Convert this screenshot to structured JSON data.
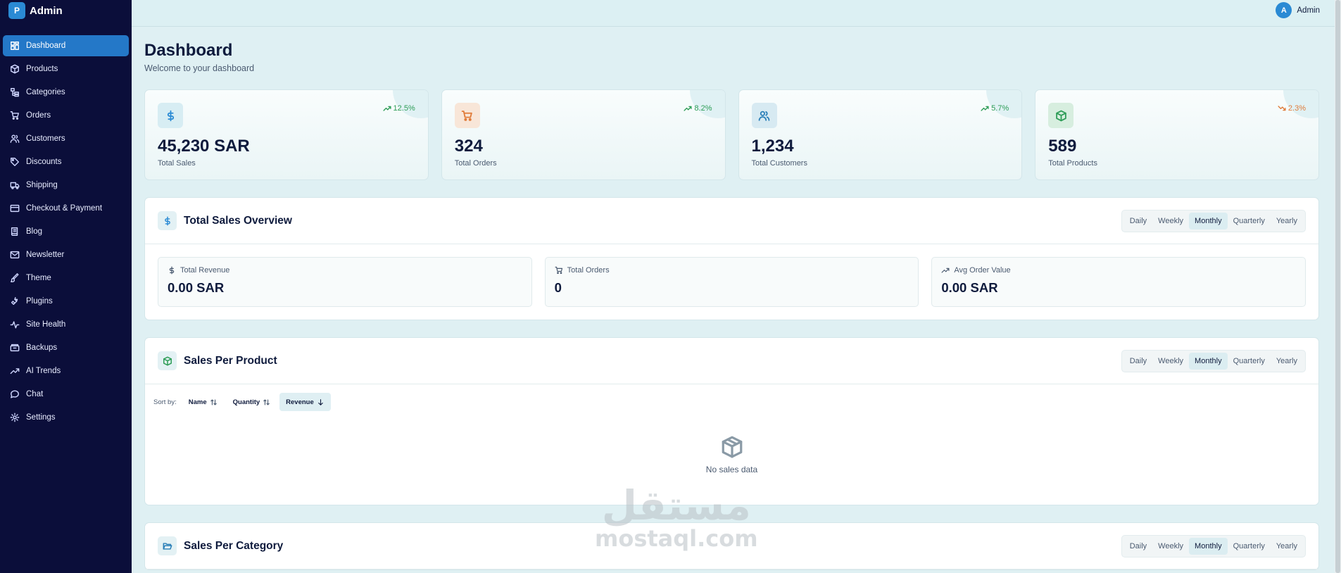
{
  "brand": {
    "logo_letter": "P",
    "name": "Admin"
  },
  "sidebar": {
    "items": [
      {
        "label": "Dashboard",
        "icon": "dashboard-icon",
        "active": true
      },
      {
        "label": "Products",
        "icon": "box-icon"
      },
      {
        "label": "Categories",
        "icon": "categories-icon"
      },
      {
        "label": "Orders",
        "icon": "cart-icon"
      },
      {
        "label": "Customers",
        "icon": "users-icon"
      },
      {
        "label": "Discounts",
        "icon": "tag-icon"
      },
      {
        "label": "Shipping",
        "icon": "truck-icon"
      },
      {
        "label": "Checkout & Payment",
        "icon": "credit-card-icon"
      },
      {
        "label": "Blog",
        "icon": "book-icon"
      },
      {
        "label": "Newsletter",
        "icon": "mail-icon"
      },
      {
        "label": "Theme",
        "icon": "paintbrush-icon"
      },
      {
        "label": "Plugins",
        "icon": "plug-icon"
      },
      {
        "label": "Site Health",
        "icon": "activity-icon"
      },
      {
        "label": "Backups",
        "icon": "backup-icon"
      },
      {
        "label": "AI Trends",
        "icon": "trend-icon"
      },
      {
        "label": "Chat",
        "icon": "chat-icon"
      },
      {
        "label": "Settings",
        "icon": "gear-icon"
      }
    ]
  },
  "header": {
    "user_initial": "A",
    "user_name": "Admin"
  },
  "page": {
    "title": "Dashboard",
    "subtitle": "Welcome to your dashboard"
  },
  "stats": [
    {
      "value": "45,230 SAR",
      "label": "Total Sales",
      "change": "12.5%",
      "trend": "up",
      "icon": "dollar-icon",
      "icon_color": "#2a8ad4",
      "icon_bg": "#d7edf3"
    },
    {
      "value": "324",
      "label": "Total Orders",
      "change": "8.2%",
      "trend": "up",
      "icon": "cart-icon",
      "icon_color": "#e07b39",
      "icon_bg": "#f8e6d8"
    },
    {
      "value": "1,234",
      "label": "Total Customers",
      "change": "5.7%",
      "trend": "up",
      "icon": "users-icon",
      "icon_color": "#2a7fb8",
      "icon_bg": "#d7eaf2"
    },
    {
      "value": "589",
      "label": "Total Products",
      "change": "2.3%",
      "trend": "down",
      "icon": "box-icon",
      "icon_color": "#2e9d57",
      "icon_bg": "#d7eedf"
    }
  ],
  "colors": {
    "trend_up": "#2e9d57",
    "trend_down": "#e07b39",
    "accent": "#2478c8",
    "sidebar_bg": "#0b0e3a"
  },
  "periods": [
    "Daily",
    "Weekly",
    "Monthly",
    "Quarterly",
    "Yearly"
  ],
  "active_period": "Monthly",
  "overview": {
    "title": "Total Sales Overview",
    "metrics": [
      {
        "label": "Total Revenue",
        "value": "0.00 SAR",
        "icon": "dollar-icon"
      },
      {
        "label": "Total Orders",
        "value": "0",
        "icon": "cart-icon"
      },
      {
        "label": "Avg Order Value",
        "value": "0.00 SAR",
        "icon": "trend-icon"
      }
    ]
  },
  "sales_per_product": {
    "title": "Sales Per Product",
    "sort_label": "Sort by:",
    "sort_options": [
      "Name",
      "Quantity",
      "Revenue"
    ],
    "active_sort": "Revenue",
    "empty_text": "No sales data"
  },
  "sales_per_category": {
    "title": "Sales Per Category"
  },
  "watermark": {
    "arabic": "مستقل",
    "latin": "mostaql.com"
  }
}
